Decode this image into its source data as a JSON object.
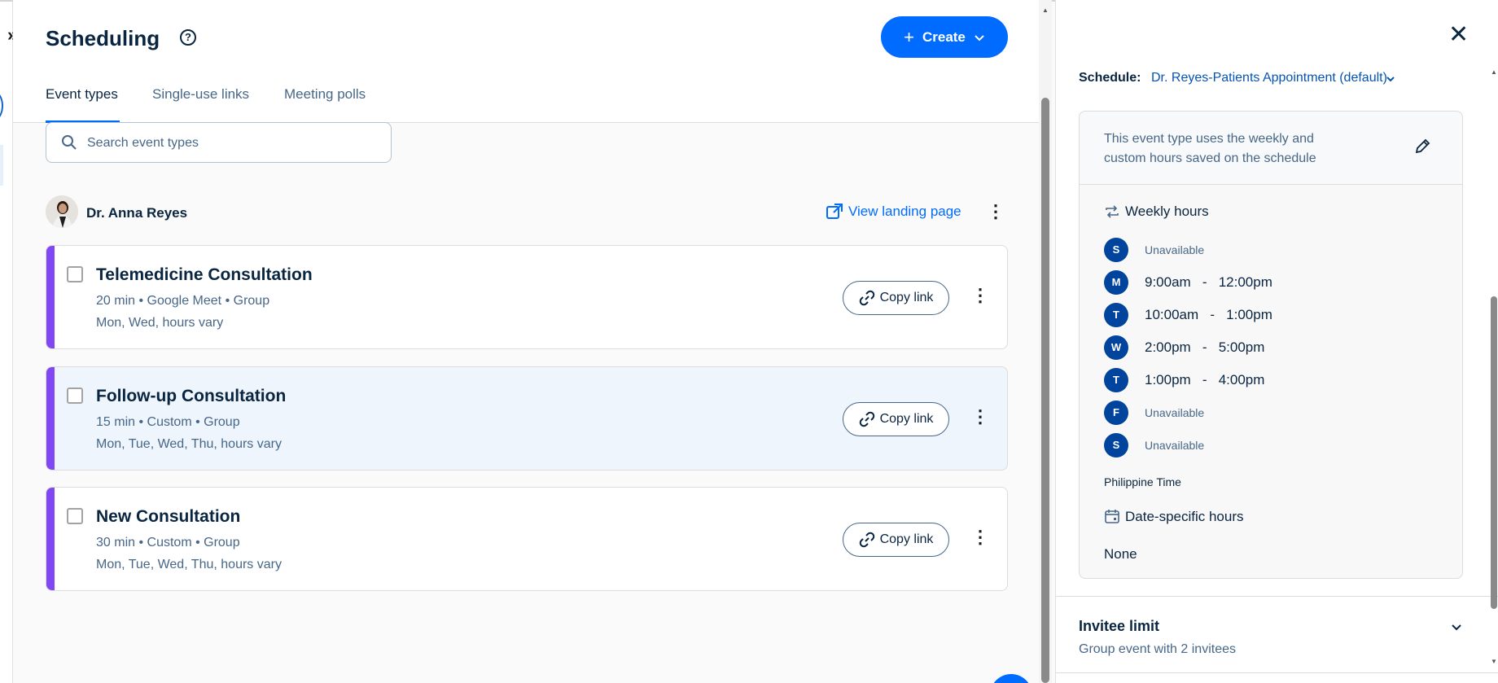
{
  "page": {
    "title": "Scheduling",
    "help_glyph": "?",
    "create_label": "Create",
    "expand_glyph": "»"
  },
  "tabs": [
    {
      "label": "Event types",
      "active": true
    },
    {
      "label": "Single-use links",
      "active": false
    },
    {
      "label": "Meeting polls",
      "active": false
    }
  ],
  "search": {
    "placeholder": "Search event types",
    "value": ""
  },
  "owner": {
    "name": "Dr. Anna Reyes",
    "landing_label": "View landing page"
  },
  "event_types": [
    {
      "name": "Telemedicine Consultation",
      "meta": "20 min • Google Meet • Group",
      "days": "Mon, Wed, hours vary",
      "copy_label": "Copy link",
      "highlighted": false
    },
    {
      "name": "Follow-up Consultation",
      "meta": "15 min • Custom • Group",
      "days": "Mon, Tue, Wed, Thu, hours vary",
      "copy_label": "Copy link",
      "highlighted": true
    },
    {
      "name": "New Consultation",
      "meta": "30 min • Custom • Group",
      "days": "Mon, Tue, Wed, Thu, hours vary",
      "copy_label": "Copy link",
      "highlighted": false
    }
  ],
  "panel": {
    "close_glyph": "✕",
    "schedule_label": "Schedule:",
    "schedule_value": "Dr. Reyes-Patients Appointment (default)",
    "note": "This event type uses the weekly and custom hours saved on the schedule",
    "weekly_title": "Weekly hours",
    "days": [
      {
        "letter": "S",
        "hours": "Unavailable",
        "available": false
      },
      {
        "letter": "M",
        "hours": "9:00am   -   12:00pm",
        "available": true
      },
      {
        "letter": "T",
        "hours": "10:00am   -   1:00pm",
        "available": true
      },
      {
        "letter": "W",
        "hours": "2:00pm   -   5:00pm",
        "available": true
      },
      {
        "letter": "T",
        "hours": "1:00pm   -   4:00pm",
        "available": true
      },
      {
        "letter": "F",
        "hours": "Unavailable",
        "available": false
      },
      {
        "letter": "S",
        "hours": "Unavailable",
        "available": false
      }
    ],
    "timezone": "Philippine Time",
    "date_specific_title": "Date-specific hours",
    "date_specific_value": "None",
    "invitee_limit_title": "Invitee limit",
    "invitee_limit_sub": "Group event with 2 invitees"
  },
  "colors": {
    "accent": "#006bff",
    "event_stripe": "#8247f5",
    "day_badge": "#00449e",
    "highlight_row": "#eef5fd"
  }
}
